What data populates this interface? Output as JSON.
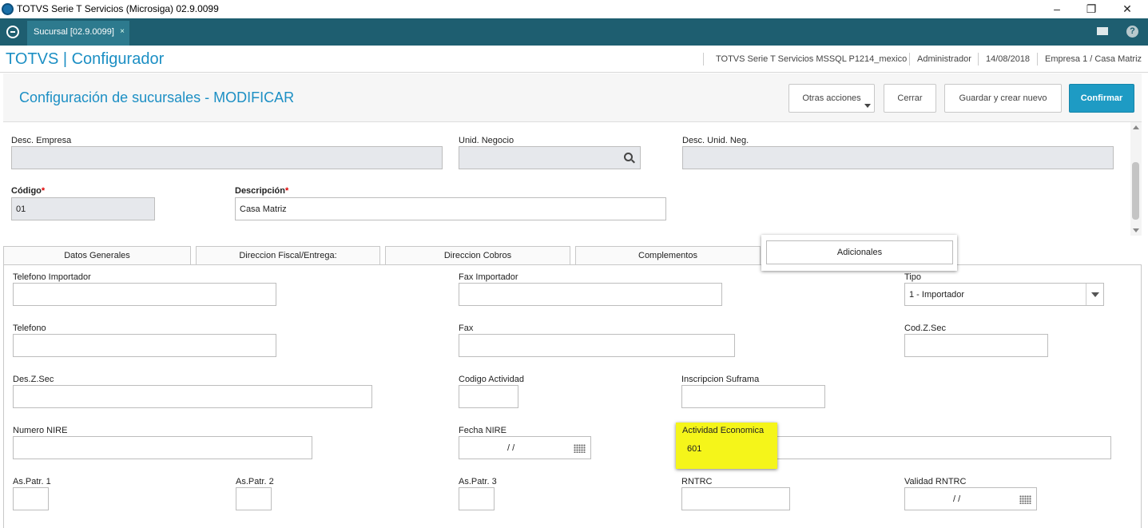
{
  "window": {
    "title": "TOTVS Serie T Servicios (Microsiga) 02.9.0099",
    "minimize": "–",
    "restore": "❐",
    "close": "✕"
  },
  "tabstrip": {
    "tab_label": "Sucursal [02.9.0099]",
    "tab_close": "×",
    "help": "?"
  },
  "header": {
    "brand": "TOTVS | Configurador",
    "environment": "TOTVS Serie T Servicios MSSQL P1214_mexico",
    "user": "Administrador",
    "date": "14/08/2018",
    "company": "Empresa 1 / Casa Matriz"
  },
  "page": {
    "title": "Configuración de sucursales - MODIFICAR",
    "buttons": {
      "other_actions": "Otras acciones",
      "close": "Cerrar",
      "save_new": "Guardar y crear nuevo",
      "confirm": "Confirmar"
    }
  },
  "form": {
    "desc_empresa_label": "Desc. Empresa",
    "desc_empresa_value": "",
    "unid_negocio_label": "Unid. Negocio",
    "unid_negocio_value": "",
    "desc_unid_neg_label": "Desc. Unid. Neg.",
    "desc_unid_neg_value": "",
    "codigo_label": "Código",
    "codigo_value": "01",
    "descripcion_label": "Descripción",
    "descripcion_value": "Casa Matriz",
    "required_mark": "*"
  },
  "tabs": [
    {
      "label": "Datos Generales"
    },
    {
      "label": "Direccion Fiscal/Entrega:"
    },
    {
      "label": "Direccion Cobros"
    },
    {
      "label": "Complementos"
    },
    {
      "label": "Adicionales"
    }
  ],
  "adicionales": {
    "telefono_importador_label": "Telefono Importador",
    "fax_importador_label": "Fax Importador",
    "tipo_label": "Tipo",
    "tipo_value": "1 - Importador",
    "telefono_label": "Telefono",
    "fax_label": "Fax",
    "cod_z_sec_label": "Cod.Z.Sec",
    "des_z_sec_label": "Des.Z.Sec",
    "codigo_actividad_label": "Codigo Actividad",
    "inscripcion_suframa_label": "Inscripcion Suframa",
    "numero_nire_label": "Numero NIRE",
    "fecha_nire_label": "Fecha NIRE",
    "fecha_nire_value": "/ /",
    "actividad_economica_label": "Actividad Economica",
    "actividad_economica_value": "601",
    "as_patr_1_label": "As.Patr. 1",
    "as_patr_2_label": "As.Patr. 2",
    "as_patr_3_label": "As.Patr. 3",
    "rntrc_label": "RNTRC",
    "validad_rntrc_label": "Validad RNTRC",
    "validad_rntrc_value": "/ /"
  },
  "colors": {
    "tabstrip": "#1e5e70",
    "accent": "#1c8fc4",
    "confirm": "#1e9bc4",
    "highlight": "#f5f51a",
    "required": "#dd0000"
  }
}
